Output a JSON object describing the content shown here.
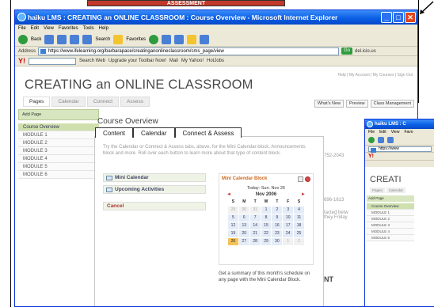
{
  "background": {
    "banner": "ASSESSMENT"
  },
  "window": {
    "title": "haiku LMS : CREATING an ONLINE CLASSROOM : Course Overview - Microsoft Internet Explorer",
    "menu": [
      "File",
      "Edit",
      "View",
      "Favorites",
      "Tools",
      "Help"
    ],
    "toolbar": {
      "back": "Back",
      "search": "Search",
      "favorites": "Favorites"
    },
    "address": {
      "label": "Address",
      "url": "https://www.ifelearning.org/barbarapace/creatinganonlineclassroom/cms_page/view",
      "go": "Go",
      "links": "del.icio.us"
    },
    "linkbar": {
      "search_web": "Search Web",
      "upgrade": "Upgrade your Toolbar Now!",
      "mail": "Mail",
      "my_yahoo": "My Yahoo!",
      "hotjobs": "HotJobs"
    }
  },
  "page": {
    "site_title": "CREATING an ONLINE CLASSROOM",
    "site_links": "Help | My Account | My Courses | Sign Out",
    "nav_tabs": [
      "Pages",
      "Calendar",
      "Connect",
      "Assess"
    ],
    "right_buttons": [
      "What's New",
      "Preview",
      "Class Management"
    ],
    "add_page": "Add Page",
    "sidebar": [
      "Course Overview",
      "MODULE 1",
      "MODULE 2",
      "MODULE 3",
      "MODULE 4",
      "MODULE 5",
      "MODULE 6"
    ],
    "course_heading": "Course Overview",
    "right_snippets": [
      "752-2043",
      "696-1613",
      "tacted betw",
      "they Friday",
      "NT"
    ]
  },
  "modal": {
    "tabs": [
      "Content",
      "Calendar",
      "Connect & Assess"
    ],
    "intro": "Try the Calendar or Connect & Assess tabs, above, for the Mini Calendar block, Announcements block and more. Roll over each button to learn more about that type of content block.",
    "blocks": [
      "Mini Calendar",
      "Upcoming Activities"
    ],
    "cancel": "Cancel",
    "calendar": {
      "title": "Mini Calendar Block",
      "today": "Today: Sun. Nov 26",
      "month": "Nov 2006",
      "prev": "◄",
      "next": "►",
      "dow": [
        "S",
        "M",
        "T",
        "W",
        "T",
        "F",
        "S"
      ],
      "weeks": [
        [
          "29",
          "30",
          "31",
          "1",
          "2",
          "3",
          "4"
        ],
        [
          "5",
          "6",
          "7",
          "8",
          "9",
          "10",
          "11"
        ],
        [
          "12",
          "13",
          "14",
          "15",
          "16",
          "17",
          "18"
        ],
        [
          "19",
          "20",
          "21",
          "22",
          "23",
          "24",
          "25"
        ],
        [
          "26",
          "27",
          "28",
          "29",
          "30",
          "1",
          "2"
        ]
      ],
      "muted": [
        "29",
        "30",
        "31"
      ],
      "today_day": "26"
    },
    "description": "Get a summary of this month's schedule on any page with the Mini Calendar Block."
  },
  "window2": {
    "title": "haiku LMS : C",
    "menu": [
      "File",
      "Edit",
      "View",
      "Favo"
    ],
    "address": "https://www",
    "site_title": "CREATI",
    "tabs": [
      "Pages",
      "Calendar"
    ],
    "add_page": "Add Page",
    "sidebar": [
      "Course Overview",
      "MODULE 1",
      "MODULE 2",
      "MODULE 3",
      "MODULE 4",
      "MODULE 5"
    ]
  }
}
